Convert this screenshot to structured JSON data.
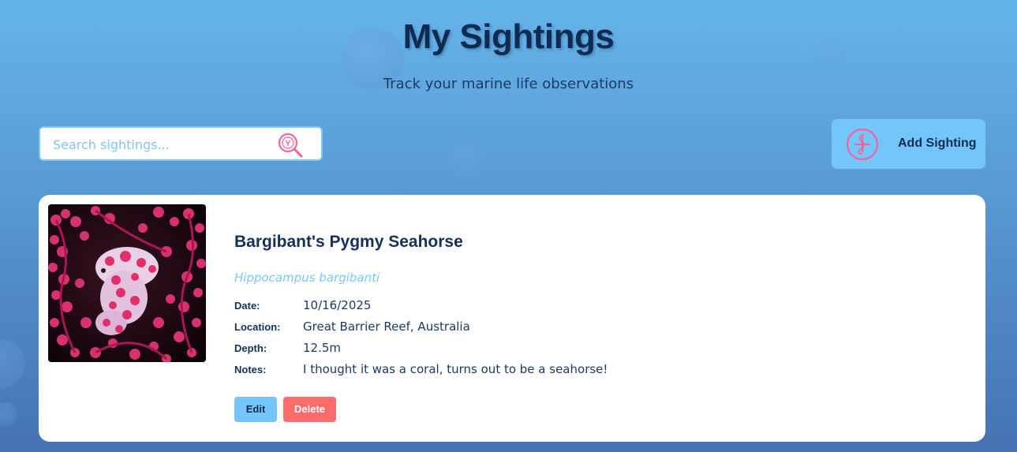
{
  "header": {
    "title": "My Sightings",
    "subtitle": "Track your marine life observations"
  },
  "search": {
    "placeholder": "Search sightings...",
    "value": "",
    "icon": "search-icon"
  },
  "toolbar": {
    "add_label": "Add Sighting",
    "add_icon": "seahorse-plus-icon"
  },
  "colors": {
    "accent": "#74c5fa",
    "danger": "#fd6b6b",
    "text_dark": "#14305a",
    "scientific_name": "#7cc7f5",
    "icon_pink": "#f2649a"
  },
  "sightings": [
    {
      "common_name": "Bargibant's Pygmy Seahorse",
      "scientific_name": "Hippocampus bargibanti",
      "photo": "pygmy-seahorse-photo",
      "fields": [
        {
          "label": "Date:",
          "value": "10/16/2025"
        },
        {
          "label": "Location:",
          "value": "Great Barrier Reef, Australia"
        },
        {
          "label": "Depth:",
          "value": "12.5m"
        },
        {
          "label": "Notes:",
          "value": "I thought it was a coral, turns out to be a seahorse!"
        }
      ],
      "actions": {
        "edit_label": "Edit",
        "delete_label": "Delete"
      }
    }
  ]
}
